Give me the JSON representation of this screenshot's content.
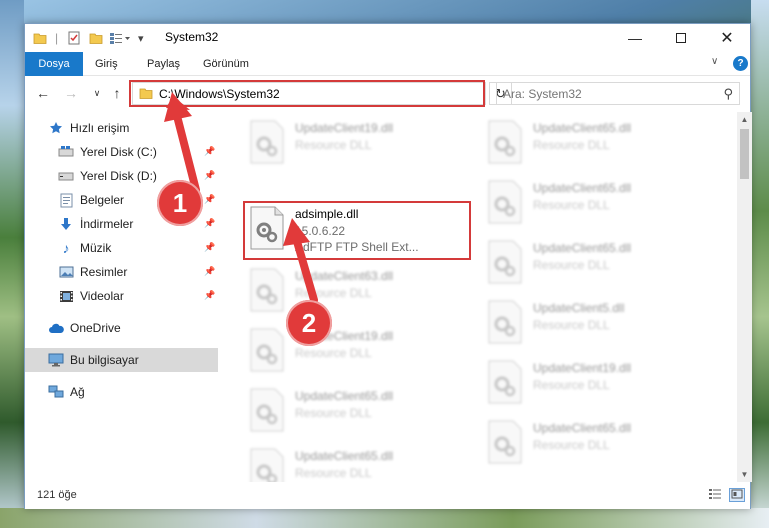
{
  "window": {
    "title": "System32",
    "minimize_icon": "minimize-icon",
    "maximize_icon": "maximize-icon",
    "close_icon": "close-icon"
  },
  "ribbon": {
    "tabs": [
      {
        "label": "Dosya"
      },
      {
        "label": "Giriş"
      },
      {
        "label": "Paylaş"
      },
      {
        "label": "Görünüm"
      }
    ],
    "accent_color": "#1979ca"
  },
  "navigation": {
    "address": "C:\\Windows\\System32",
    "search_placeholder": "Ara: System32"
  },
  "sidebar": {
    "items": [
      {
        "label": "Hızlı erişim",
        "icon": "star-icon"
      },
      {
        "label": "Yerel Disk (C:)",
        "icon": "drive-icon",
        "pinned": true
      },
      {
        "label": "Yerel Disk (D:)",
        "icon": "drive-icon",
        "pinned": true
      },
      {
        "label": "Belgeler",
        "icon": "documents-icon",
        "pinned": true
      },
      {
        "label": "İndirmeler",
        "icon": "download-icon",
        "pinned": true
      },
      {
        "label": "Müzik",
        "icon": "music-icon",
        "pinned": true
      },
      {
        "label": "Resimler",
        "icon": "pictures-icon",
        "pinned": true
      },
      {
        "label": "Videolar",
        "icon": "videos-icon",
        "pinned": true
      },
      {
        "label": "OneDrive",
        "icon": "cloud-icon"
      },
      {
        "label": "Bu bilgisayar",
        "icon": "computer-icon",
        "selected": true
      },
      {
        "label": "Ağ",
        "icon": "network-icon"
      }
    ]
  },
  "files": {
    "left_column": [
      {
        "name": "UpdateClient19.dll",
        "type": "Resource DLL"
      },
      {
        "name": "adsimple.dll",
        "version": "15.0.6.22",
        "description": "AdFTP FTP Shell Ext..."
      },
      {
        "name": "UpdateClient63.dll",
        "type": "Resource DLL"
      },
      {
        "name": "UpdateClient19.dll",
        "type": "Resource DLL"
      },
      {
        "name": "UpdateClient65.dll",
        "type": "Resource DLL"
      },
      {
        "name": "UpdateClient65.dll",
        "type": "Resource DLL"
      }
    ],
    "right_column": [
      {
        "name": "UpdateClient65.dll",
        "type": "Resource DLL"
      },
      {
        "name": "UpdateClient65.dll",
        "type": "Resource DLL"
      },
      {
        "name": "UpdateClient65.dll",
        "type": "Resource DLL"
      },
      {
        "name": "UpdateClient5.dll",
        "type": "Resource DLL"
      },
      {
        "name": "UpdateClient19.dll",
        "type": "Resource DLL"
      },
      {
        "name": "UpdateClient65.dll",
        "type": "Resource DLL"
      }
    ]
  },
  "status": {
    "item_count": "121 öğe"
  },
  "annotations": {
    "step1": "1",
    "step2": "2",
    "highlight_color": "#d43a3a"
  }
}
